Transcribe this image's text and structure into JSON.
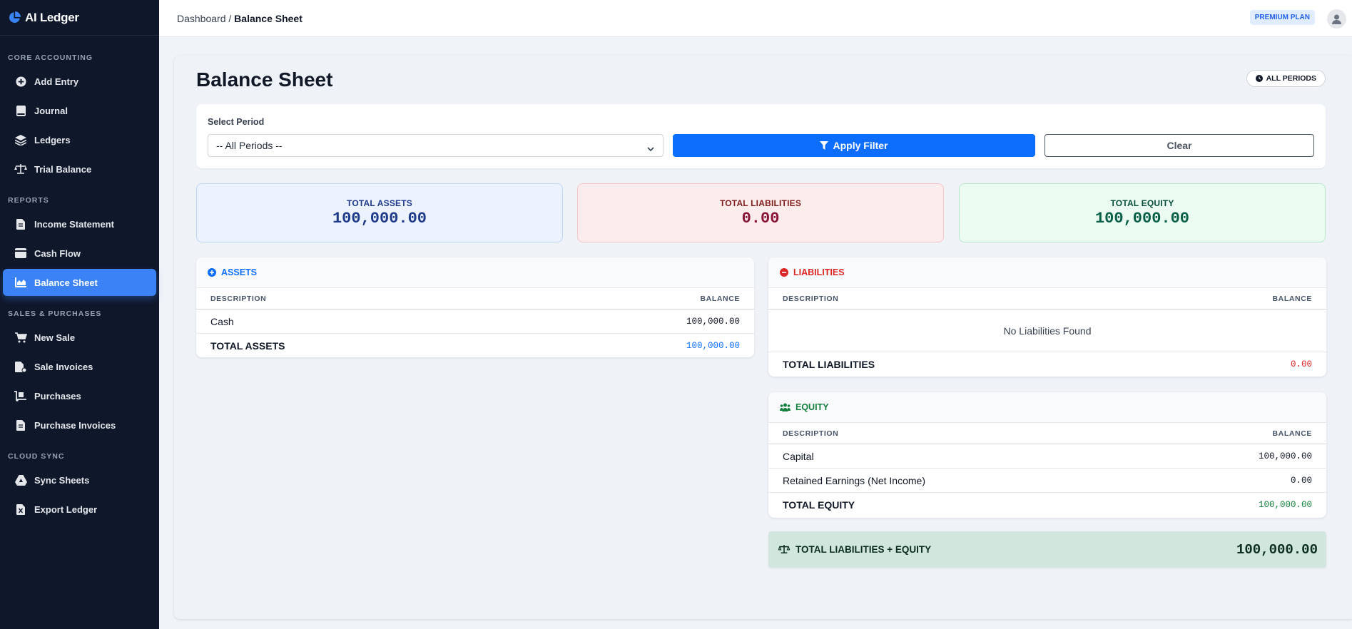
{
  "app": {
    "name": "AI Ledger"
  },
  "sidebar": {
    "sections": [
      {
        "label": "CORE ACCOUNTING",
        "items": [
          "Add Entry",
          "Journal",
          "Ledgers",
          "Trial Balance"
        ]
      },
      {
        "label": "REPORTS",
        "items": [
          "Income Statement",
          "Cash Flow",
          "Balance Sheet"
        ]
      },
      {
        "label": "SALES & PURCHASES",
        "items": [
          "New Sale",
          "Sale Invoices",
          "Purchases",
          "Purchase Invoices"
        ]
      },
      {
        "label": "CLOUD SYNC",
        "items": [
          "Sync Sheets",
          "Export Ledger"
        ]
      }
    ],
    "active": "Balance Sheet"
  },
  "topbar": {
    "breadcrumb_root": "Dashboard",
    "breadcrumb_sep": " / ",
    "breadcrumb_current": "Balance Sheet",
    "plan": "PREMIUM PLAN"
  },
  "page": {
    "title": "Balance Sheet",
    "period_badge": "ALL PERIODS"
  },
  "filter": {
    "label": "Select Period",
    "selected": "-- All Periods --",
    "apply_label": "Apply Filter",
    "clear_label": "Clear"
  },
  "summary": {
    "assets": {
      "label": "TOTAL ASSETS",
      "value": "100,000.00"
    },
    "liabilities": {
      "label": "TOTAL LIABILITIES",
      "value": "0.00"
    },
    "equity": {
      "label": "TOTAL EQUITY",
      "value": "100,000.00"
    }
  },
  "assets": {
    "title": "ASSETS",
    "col_desc": "DESCRIPTION",
    "col_bal": "BALANCE",
    "rows": [
      {
        "desc": "Cash",
        "bal": "100,000.00"
      }
    ],
    "total_label": "TOTAL ASSETS",
    "total_value": "100,000.00"
  },
  "liabilities": {
    "title": "LIABILITIES",
    "col_desc": "DESCRIPTION",
    "col_bal": "BALANCE",
    "empty": "No Liabilities Found",
    "total_label": "TOTAL LIABILITIES",
    "total_value": "0.00"
  },
  "equity": {
    "title": "EQUITY",
    "col_desc": "DESCRIPTION",
    "col_bal": "BALANCE",
    "rows": [
      {
        "desc": "Capital",
        "bal": "100,000.00"
      },
      {
        "desc": "Retained Earnings (Net Income)",
        "bal": "0.00"
      }
    ],
    "total_label": "TOTAL EQUITY",
    "total_value": "100,000.00"
  },
  "grand_total": {
    "label": "TOTAL LIABILITIES + EQUITY",
    "value": "100,000.00"
  },
  "colors": {
    "primary": "#0d6efd",
    "sidebar_bg": "#0f172a",
    "active": "#3b82f6",
    "asset": "#1d4ed8",
    "liability": "#dc2626",
    "equity": "#15803d"
  }
}
